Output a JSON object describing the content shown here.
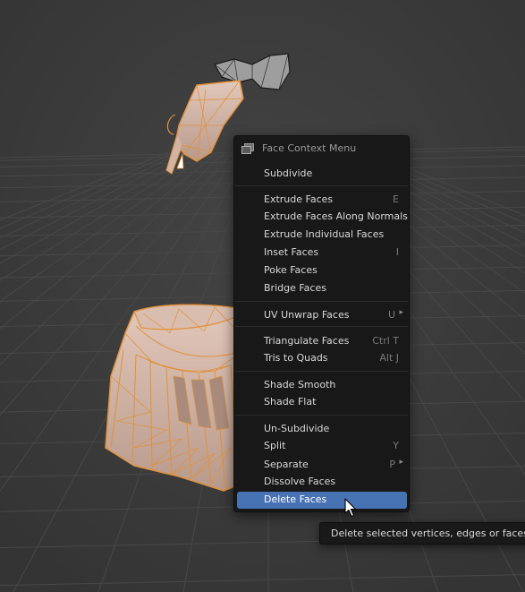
{
  "menu": {
    "title": "Face Context Menu",
    "items": [
      {
        "label": "Subdivide",
        "shortcut": ""
      },
      {
        "label": "Extrude Faces",
        "shortcut": "E"
      },
      {
        "label": "Extrude Faces Along Normals",
        "shortcut": ""
      },
      {
        "label": "Extrude Individual Faces",
        "shortcut": ""
      },
      {
        "label": "Inset Faces",
        "shortcut": "I"
      },
      {
        "label": "Poke Faces",
        "shortcut": ""
      },
      {
        "label": "Bridge Faces",
        "shortcut": ""
      },
      {
        "label": "UV Unwrap Faces",
        "shortcut": "U",
        "submenu": "▸"
      },
      {
        "label": "Triangulate Faces",
        "shortcut": "Ctrl T"
      },
      {
        "label": "Tris to Quads",
        "shortcut": "Alt J"
      },
      {
        "label": "Shade Smooth",
        "shortcut": ""
      },
      {
        "label": "Shade Flat",
        "shortcut": ""
      },
      {
        "label": "Un-Subdivide",
        "shortcut": ""
      },
      {
        "label": "Split",
        "shortcut": "Y"
      },
      {
        "label": "Separate",
        "shortcut": "P",
        "submenu": "▸"
      },
      {
        "label": "Dissolve Faces",
        "shortcut": ""
      },
      {
        "label": "Delete Faces",
        "shortcut": ""
      }
    ]
  },
  "tooltip": {
    "text": "Delete selected vertices, edges or faces:",
    "highlight": "Fa"
  },
  "colors": {
    "viewport_bg": "#3d3d3d",
    "grid_line": "#474747",
    "selection_orange": "#e0913a",
    "mesh_skin": "#d7b8aa",
    "menu_bg": "#181818",
    "active_item": "#4772b3"
  },
  "icons": {
    "menu_header": "face-select-mode-icon",
    "cursor": "mouse-pointer-icon"
  }
}
